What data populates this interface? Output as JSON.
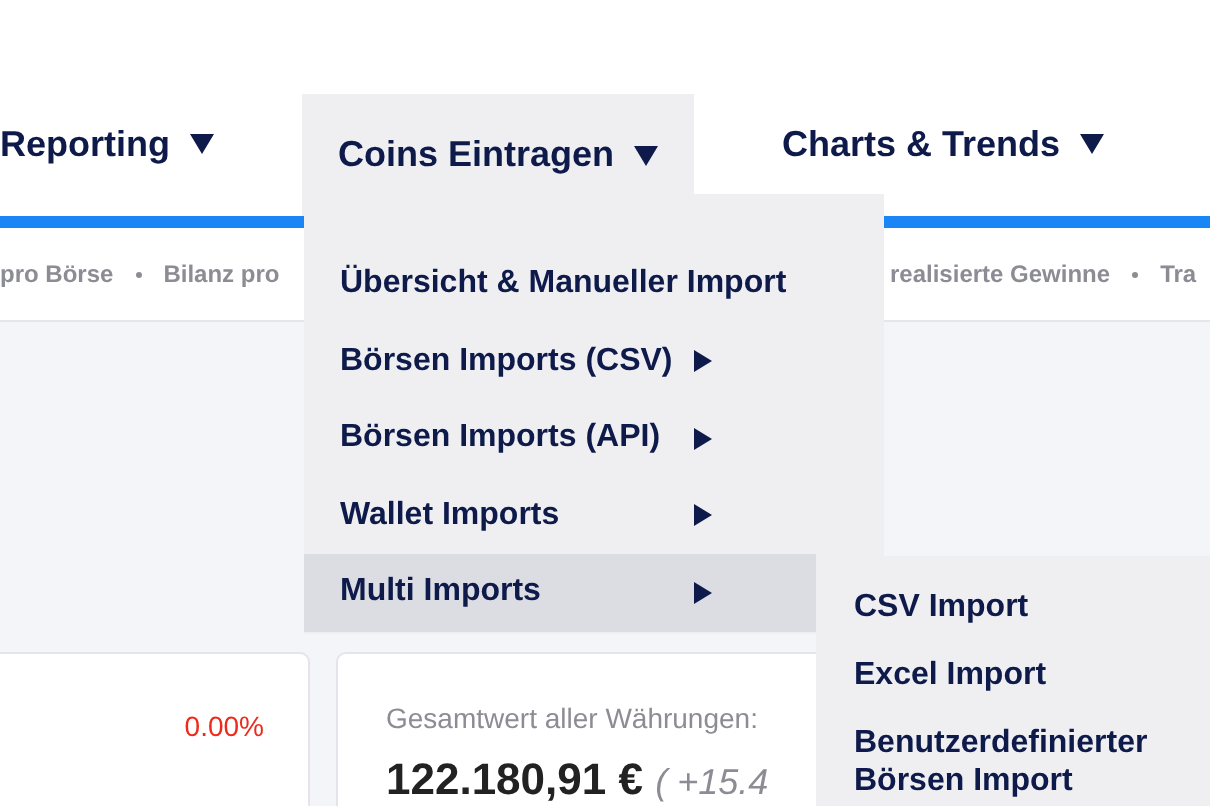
{
  "nav": [
    {
      "label": "Reporting",
      "selected": false
    },
    {
      "label": "Coins Eintragen",
      "selected": true
    },
    {
      "label": "Charts & Trends",
      "selected": false
    }
  ],
  "subnav": [
    {
      "label": "pro Börse"
    },
    {
      "label": "Bilanz pro"
    },
    {
      "label": "realisierte Gewinne"
    },
    {
      "label": "Tra"
    }
  ],
  "menu": [
    {
      "label": "Übersicht & Manueller Import",
      "has_submenu": false,
      "selected": false
    },
    {
      "label": "Börsen Imports (CSV)",
      "has_submenu": true,
      "selected": false
    },
    {
      "label": "Börsen Imports (API)",
      "has_submenu": true,
      "selected": false
    },
    {
      "label": "Wallet Imports",
      "has_submenu": true,
      "selected": false
    },
    {
      "label": "Multi Imports",
      "has_submenu": true,
      "selected": true
    }
  ],
  "submenu": [
    {
      "label": "CSV Import"
    },
    {
      "label": "Excel Import"
    },
    {
      "label": "Benutzerdefinierter Börsen Import"
    }
  ],
  "cards": [
    {
      "kind": "change",
      "value": "0.00%"
    },
    {
      "kind": "total",
      "label": "Gesamtwert aller Währungen:",
      "value": "122.180,91 €",
      "change": "( +15.4"
    }
  ]
}
